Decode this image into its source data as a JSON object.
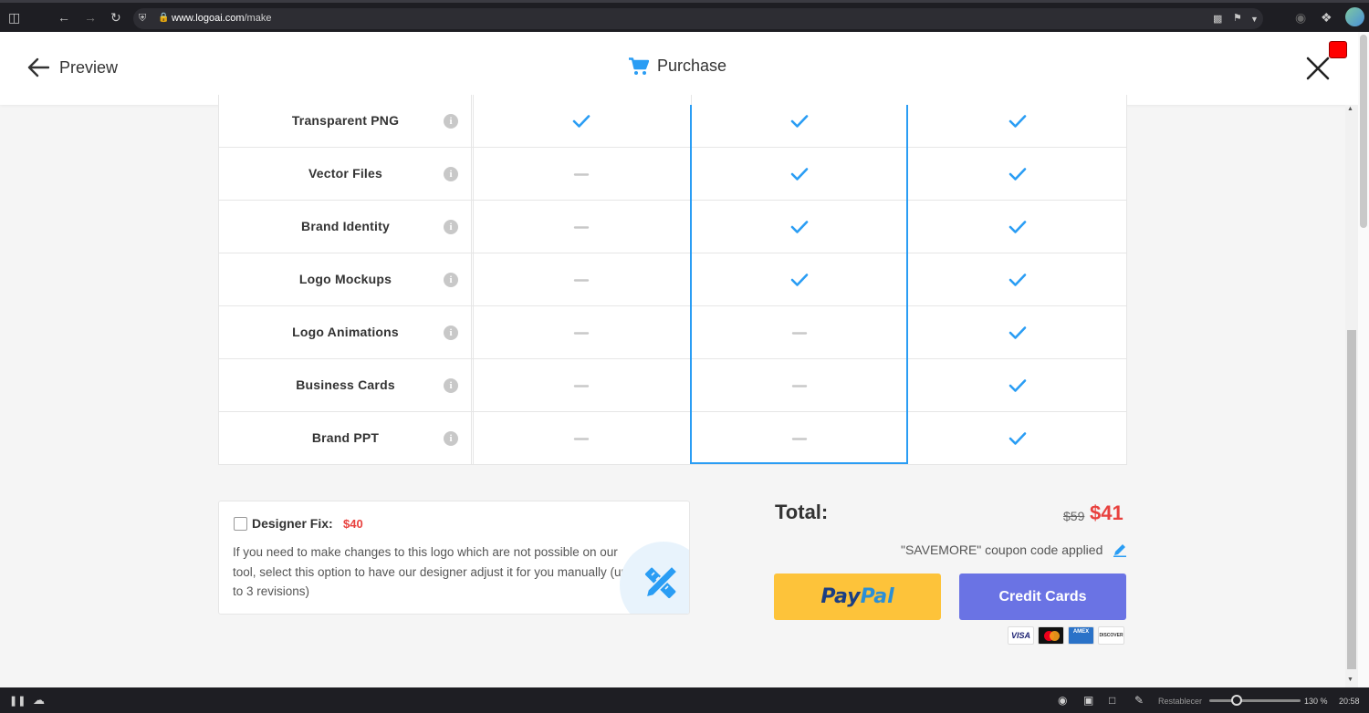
{
  "browser": {
    "url_host": "www.logoai.com",
    "url_path": "/make"
  },
  "header": {
    "back_label": "Preview",
    "title": "Purchase"
  },
  "features": [
    {
      "name": "Transparent PNG",
      "basic": true,
      "pro": true,
      "premium": true
    },
    {
      "name": "Vector Files",
      "basic": false,
      "pro": true,
      "premium": true
    },
    {
      "name": "Brand Identity",
      "basic": false,
      "pro": true,
      "premium": true
    },
    {
      "name": "Logo Mockups",
      "basic": false,
      "pro": true,
      "premium": true
    },
    {
      "name": "Logo Animations",
      "basic": false,
      "pro": false,
      "premium": true
    },
    {
      "name": "Business Cards",
      "basic": false,
      "pro": false,
      "premium": true
    },
    {
      "name": "Brand PPT",
      "basic": false,
      "pro": false,
      "premium": true
    }
  ],
  "designer_fix": {
    "title": "Designer Fix:",
    "price": "$40",
    "description": "If you need to make changes to this logo which are not possible on our tool, select this option to have our designer adjust it for you manually (up to 3 revisions)",
    "checked": false
  },
  "totals": {
    "label": "Total:",
    "old_price": "$59",
    "new_price": "$41",
    "coupon_text": "\"SAVEMORE\" coupon code applied"
  },
  "payment": {
    "paypal_part1": "Pay",
    "paypal_part2": "Pal",
    "credit_cards_label": "Credit Cards",
    "card_brands": [
      "VISA",
      "Mastercard",
      "AMEX",
      "DISCOVER"
    ]
  },
  "statusbar": {
    "reset_label": "Restablecer",
    "zoom": "130 %",
    "time": "20:58",
    "zoom_level": 0.3
  },
  "colors": {
    "accent_blue": "#2a9df4",
    "price_red": "#e8413e",
    "paypal_yellow": "#fdc33a",
    "credit_purple": "#6a73e4",
    "dash_gray": "#c8c8c8"
  }
}
